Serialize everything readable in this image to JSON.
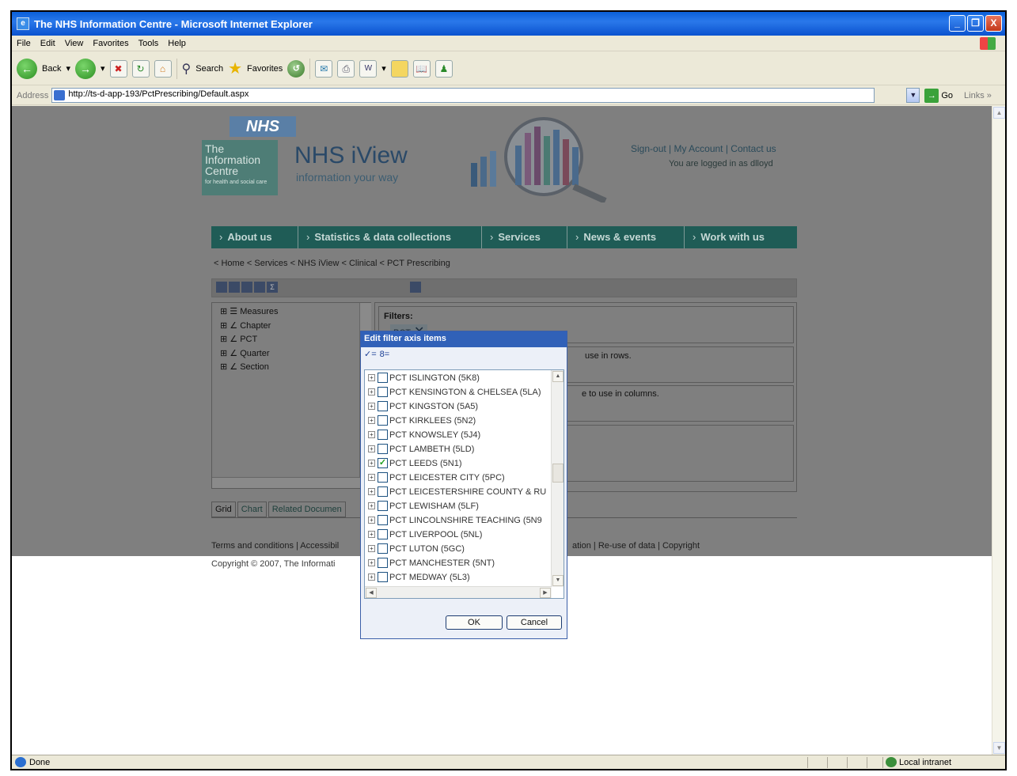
{
  "window": {
    "title": "The NHS Information Centre - Microsoft Internet Explorer",
    "buttons": [
      "_",
      "❐",
      "X"
    ]
  },
  "menu": [
    "File",
    "Edit",
    "View",
    "Favorites",
    "Tools",
    "Help"
  ],
  "toolbar": {
    "back": "Back",
    "search": "Search",
    "favorites": "Favorites"
  },
  "address": {
    "label": "Address",
    "url": "http://ts-d-app-193/PctPrescribing/Default.aspx",
    "go": "Go",
    "links": "Links"
  },
  "page": {
    "nhs_logo": "NHS",
    "ic_line1": "The",
    "ic_line2": "Information",
    "ic_line3": "Centre",
    "ic_tag": "for health and social care",
    "site_title": "NHS iView",
    "site_tagline": "information your way",
    "top_links": "Sign-out | My Account | Contact us",
    "logged_in": "You are logged in as dlloyd",
    "nav": [
      "About us",
      "Statistics & data collections",
      "Services",
      "News & events",
      "Work with us"
    ],
    "breadcrumb": "< Home < Services < NHS iView < Clinical < PCT Prescribing",
    "tree": [
      "Measures",
      "Chapter",
      "PCT",
      "Quarter",
      "Section"
    ],
    "filters_label": "Filters:",
    "filter_chip": "PCT",
    "rows_hint": "use in rows.",
    "cols_hint": "e to use in columns.",
    "tabs": [
      "Grid",
      "Chart",
      "Related Documen"
    ],
    "footer_left": "Terms and conditions  | Accessibil",
    "footer_right": "ation  | Re-use of data  | Copyright",
    "copyright": "Copyright © 2007, The Informati"
  },
  "dialog": {
    "title": "Edit filter axis items",
    "tools": [
      "✓=",
      "8="
    ],
    "items": [
      {
        "label": "PCT ISLINGTON (5K8)",
        "checked": false
      },
      {
        "label": "PCT KENSINGTON & CHELSEA (5LA)",
        "checked": false
      },
      {
        "label": "PCT KINGSTON (5A5)",
        "checked": false
      },
      {
        "label": "PCT KIRKLEES (5N2)",
        "checked": false
      },
      {
        "label": "PCT KNOWSLEY (5J4)",
        "checked": false
      },
      {
        "label": "PCT LAMBETH (5LD)",
        "checked": false
      },
      {
        "label": "PCT LEEDS (5N1)",
        "checked": true
      },
      {
        "label": "PCT LEICESTER CITY (5PC)",
        "checked": false
      },
      {
        "label": "PCT LEICESTERSHIRE COUNTY & RU",
        "checked": false
      },
      {
        "label": "PCT LEWISHAM (5LF)",
        "checked": false
      },
      {
        "label": "PCT LINCOLNSHIRE TEACHING (5N9",
        "checked": false
      },
      {
        "label": "PCT LIVERPOOL (5NL)",
        "checked": false
      },
      {
        "label": "PCT LUTON (5GC)",
        "checked": false
      },
      {
        "label": "PCT MANCHESTER (5NT)",
        "checked": false
      },
      {
        "label": "PCT MEDWAY (5L3)",
        "checked": false
      }
    ],
    "ok": "OK",
    "cancel": "Cancel"
  },
  "status": {
    "text": "Done",
    "zone": "Local intranet"
  }
}
